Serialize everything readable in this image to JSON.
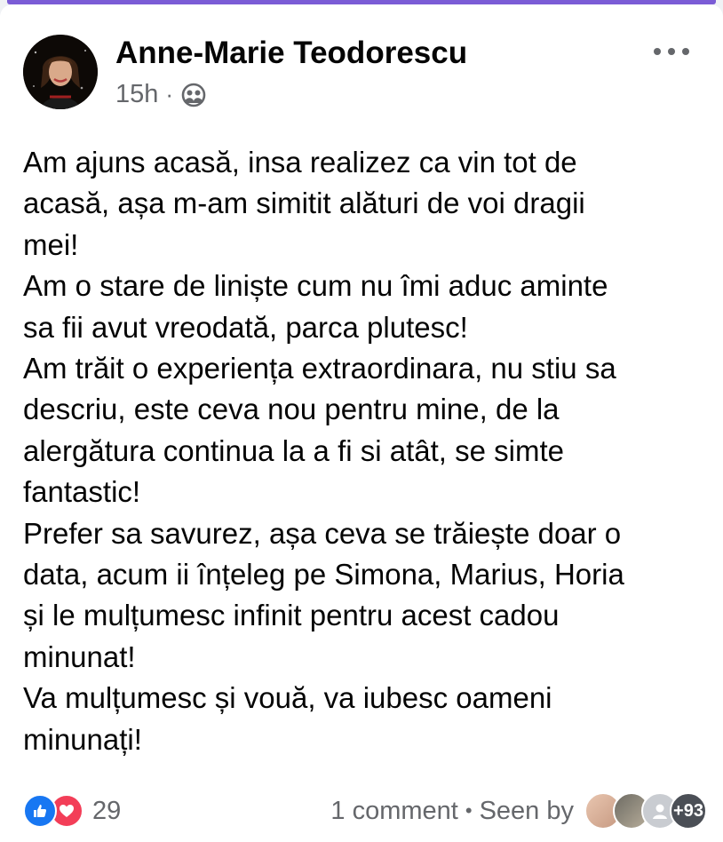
{
  "post": {
    "author": "Anne-Marie Teodorescu",
    "time": "15h",
    "separator": "·",
    "audience_icon": "friends-icon",
    "more_icon": "more-options-icon",
    "body_lines": [
      "Am ajuns acasă, insa realizez ca vin tot de",
      "acasă, așa m-am simitit alături de voi dragii",
      "mei!",
      "Am o stare de liniște cum nu îmi aduc aminte",
      "sa fii avut vreodată, parca plutesc!",
      "Am trăit o experiența extraordinara, nu stiu sa",
      "descriu, este ceva nou pentru mine, de la",
      "alergătura continua la a fi si atât, se simte",
      "fantastic!",
      "Prefer sa savurez, așa ceva se trăiește doar o",
      "data, acum ii înțeleg pe Simona, Marius, Horia",
      "și le mulțumesc infinit pentru acest cadou",
      "minunat!",
      "Va mulțumesc și vouă, va iubesc oameni",
      "minunați!"
    ]
  },
  "footer": {
    "reactions": [
      "like",
      "love"
    ],
    "reaction_count": "29",
    "comments": "1 comment",
    "bullet": "•",
    "seen_by": "Seen by",
    "seen_more": "+93"
  },
  "colors": {
    "accent": "#7b5cd6",
    "like": "#1877f2",
    "love": "#f33e58",
    "secondary_text": "#65676b"
  }
}
